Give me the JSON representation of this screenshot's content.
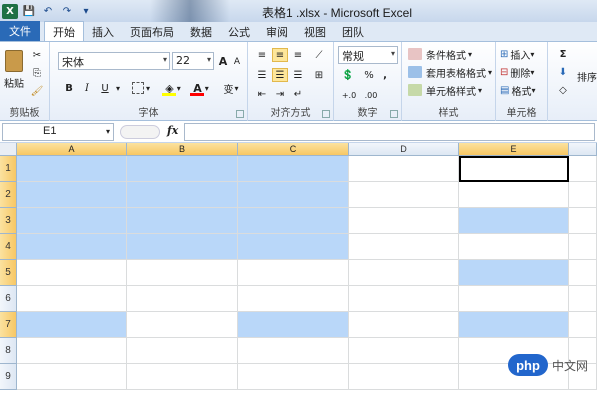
{
  "app": {
    "title": "表格1 .xlsx - Microsoft Excel",
    "brand_color": "#1e7145",
    "logo_letter": "X"
  },
  "quick_access": [
    {
      "icon": "save-icon",
      "glyph": "💾"
    },
    {
      "icon": "undo-icon",
      "glyph": "↶"
    },
    {
      "icon": "redo-icon",
      "glyph": "↷"
    },
    {
      "icon": "customize-qat-icon",
      "glyph": "▾"
    }
  ],
  "tabs": {
    "file": "文件",
    "items": [
      "开始",
      "插入",
      "页面布局",
      "数据",
      "公式",
      "审阅",
      "视图",
      "团队"
    ],
    "active_index": 0
  },
  "ribbon": {
    "clipboard": {
      "label": "剪贴板",
      "paste": "粘贴"
    },
    "font": {
      "label": "字体",
      "font_name": "宋体",
      "font_size": "22",
      "grow": "A",
      "shrink": "A",
      "bold": "B",
      "italic": "I",
      "underline": "U",
      "font_color_label": "A",
      "wen": "变",
      "fill_color": "#ffff00",
      "font_color": "#ff0000"
    },
    "alignment": {
      "label": "对齐方式"
    },
    "number": {
      "label": "数字",
      "format": "常规",
      "percent": "%",
      "comma": ","
    },
    "styles": {
      "label": "样式",
      "conditional": "条件格式",
      "table": "套用表格格式",
      "cell_styles": "单元格样式"
    },
    "cells": {
      "label": "单元格",
      "insert": "插入",
      "delete": "删除",
      "format": "格式"
    },
    "editing": {
      "sigma": "Σ",
      "sort": "排序"
    }
  },
  "formula_bar": {
    "name_box": "E1",
    "fx": "fx",
    "formula": ""
  },
  "sheet": {
    "columns": [
      "A",
      "B",
      "C",
      "D",
      "E"
    ],
    "rows": [
      "1",
      "2",
      "3",
      "4",
      "5",
      "6",
      "7",
      "8",
      "9"
    ],
    "highlighted_columns": [
      "A",
      "B",
      "C",
      "E"
    ],
    "highlighted_rows": [
      "1",
      "2",
      "3",
      "4",
      "5",
      "7"
    ],
    "selection_color": "#b9d7f9",
    "active_cell": "E1"
  },
  "watermark": {
    "logo": "php",
    "text": "中文网"
  }
}
